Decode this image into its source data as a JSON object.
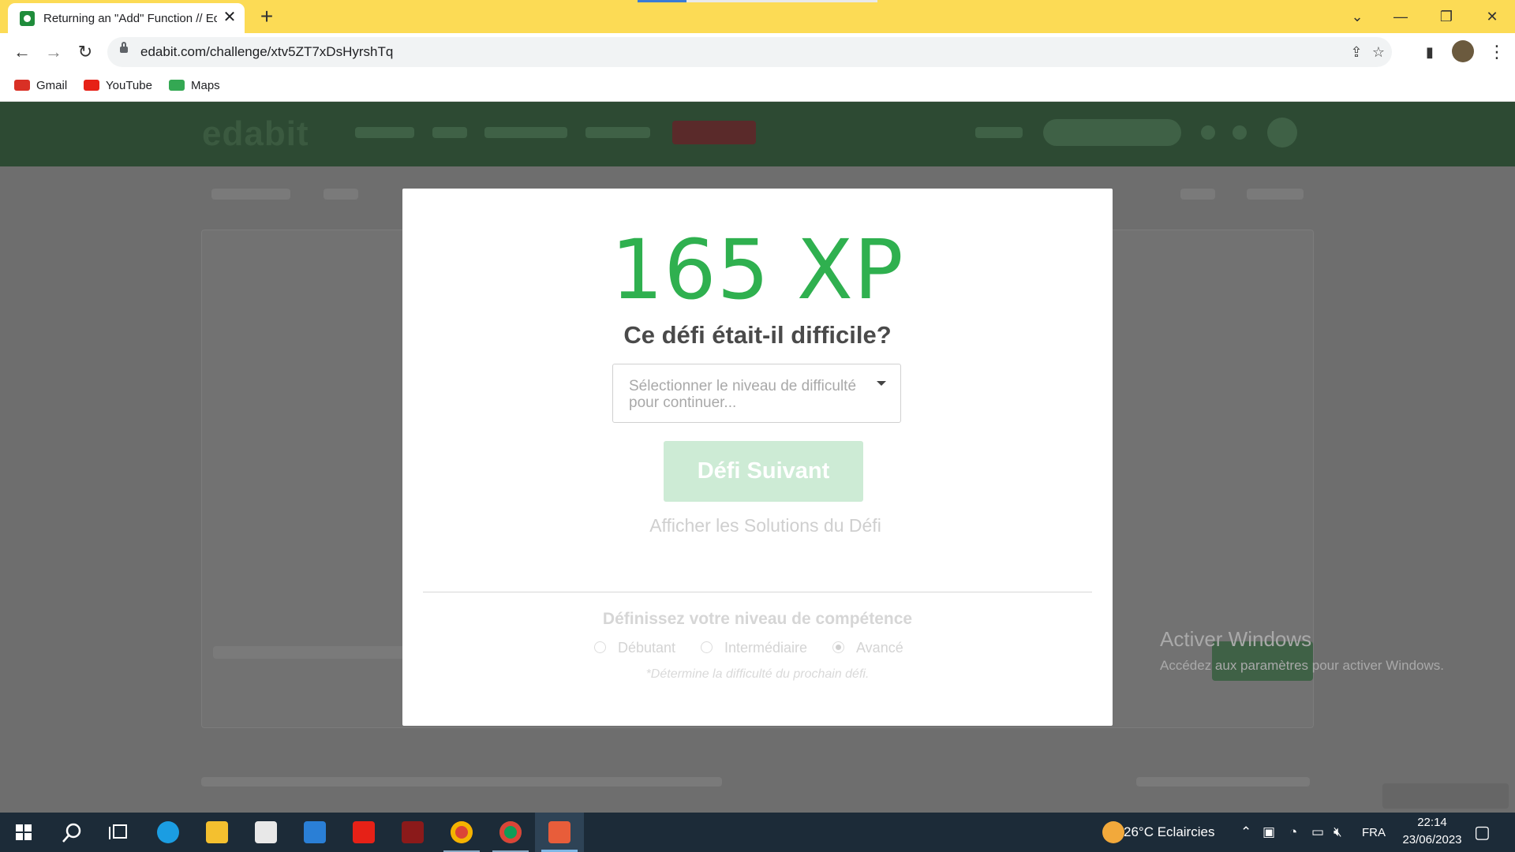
{
  "browser": {
    "tab_title": "Returning an \"Add\" Function // Edabit",
    "tab_close": "✕",
    "new_tab": "+",
    "url": "edabit.com/challenge/xtv5ZT7xDsHyrshTq",
    "bookmarks": [
      {
        "label": "Gmail",
        "color": "#d93025"
      },
      {
        "label": "YouTube",
        "color": "#e62117"
      },
      {
        "label": "Maps",
        "color": "#34a853"
      }
    ]
  },
  "modal": {
    "xp": "165 XP",
    "question": "Ce défi était-il difficile?",
    "select_placeholder": "Sélectionner le niveau de difficulté pour continuer...",
    "next_button": "Défi Suivant",
    "solutions_link": "Afficher les Solutions du Défi",
    "skill_title": "Définissez votre niveau de compétence",
    "levels": [
      {
        "label": "Débutant",
        "checked": false
      },
      {
        "label": "Intermédiaire",
        "checked": false
      },
      {
        "label": "Avancé",
        "checked": true
      }
    ],
    "note": "*Détermine la difficulté du prochain défi."
  },
  "background": {
    "logo": "edabit"
  },
  "watermark": {
    "title": "Activer Windows",
    "subtitle": "Accédez aux paramètres pour activer Windows."
  },
  "taskbar": {
    "weather": "26°C  Eclaircies",
    "language": "FRA",
    "time": "22:14",
    "date": "23/06/2023"
  },
  "colors": {
    "accent_green": "#2fb04f",
    "tab_bar": "#fcdb55",
    "header_green": "#2d4a33"
  }
}
